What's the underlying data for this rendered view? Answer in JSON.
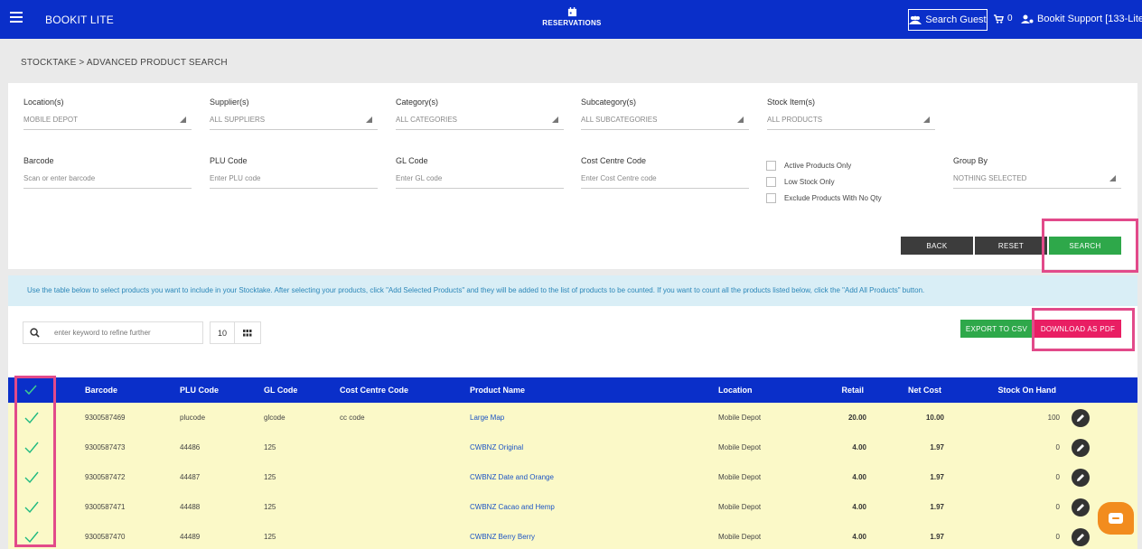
{
  "header": {
    "app_title": "BOOKIT LITE",
    "nav_label": "RESERVATIONS",
    "search_guest": "Search Guest",
    "cart_count": "0",
    "user": "Bookit Support [133-Lite]"
  },
  "breadcrumb": "STOCKTAKE > ADVANCED PRODUCT SEARCH",
  "filters": {
    "location": {
      "label": "Location(s)",
      "value": "MOBILE DEPOT"
    },
    "supplier": {
      "label": "Supplier(s)",
      "value": "ALL SUPPLIERS"
    },
    "category": {
      "label": "Category(s)",
      "value": "ALL CATEGORIES"
    },
    "subcategory": {
      "label": "Subcategory(s)",
      "value": "ALL SUBCATEGORIES"
    },
    "stock_item": {
      "label": "Stock Item(s)",
      "value": "ALL PRODUCTS"
    },
    "barcode": {
      "label": "Barcode",
      "placeholder": "Scan or enter barcode"
    },
    "plu": {
      "label": "PLU Code",
      "placeholder": "Enter PLU code"
    },
    "gl": {
      "label": "GL Code",
      "placeholder": "Enter GL code"
    },
    "cost_centre": {
      "label": "Cost Centre Code",
      "placeholder": "Enter Cost Centre code"
    },
    "checks": [
      "Active Products Only",
      "Low Stock Only",
      "Exclude Products With No Qty"
    ],
    "group_by": {
      "label": "Group By",
      "value": "NOTHING SELECTED"
    }
  },
  "buttons": {
    "back": "BACK",
    "reset": "RESET",
    "search": "SEARCH",
    "export_csv": "EXPORT TO CSV",
    "download_pdf": "DOWNLOAD AS PDF"
  },
  "info": "Use the table below to select products you want to include in your Stocktake. After selecting your products, click \"Add Selected Products\" and they will be added to the list of products to be counted. If you want to count all the products listed below, click the \"Add All Products\" button.",
  "table_tools": {
    "search_placeholder": "enter keyword to refine further",
    "page_size": "10"
  },
  "table": {
    "columns": [
      "Barcode",
      "PLU Code",
      "GL Code",
      "Cost Centre Code",
      "Product Name",
      "Location",
      "Retail",
      "Net Cost",
      "Stock On Hand"
    ],
    "rows": [
      {
        "barcode": "9300587469",
        "plu": "plucode",
        "gl": "glcode",
        "cc": "cc code",
        "name": "Large Map",
        "location": "Mobile Depot",
        "retail": "20.00",
        "net": "10.00",
        "stock": "100"
      },
      {
        "barcode": "9300587473",
        "plu": "44486",
        "gl": "125",
        "cc": "",
        "name": "CWBNZ Original",
        "location": "Mobile Depot",
        "retail": "4.00",
        "net": "1.97",
        "stock": "0"
      },
      {
        "barcode": "9300587472",
        "plu": "44487",
        "gl": "125",
        "cc": "",
        "name": "CWBNZ Date and Orange",
        "location": "Mobile Depot",
        "retail": "4.00",
        "net": "1.97",
        "stock": "0"
      },
      {
        "barcode": "9300587471",
        "plu": "44488",
        "gl": "125",
        "cc": "",
        "name": "CWBNZ Cacao and Hemp",
        "location": "Mobile Depot",
        "retail": "4.00",
        "net": "1.97",
        "stock": "0"
      },
      {
        "barcode": "9300587470",
        "plu": "44489",
        "gl": "125",
        "cc": "",
        "name": "CWBNZ Berry Berry",
        "location": "Mobile Depot",
        "retail": "4.00",
        "net": "1.97",
        "stock": "0"
      }
    ]
  },
  "colors": {
    "header_blue": "#0a2fc9",
    "green": "#2ea84a",
    "pink": "#e91e63",
    "highlight": "#e24a8a",
    "row_yellow": "#fbf9c8"
  }
}
